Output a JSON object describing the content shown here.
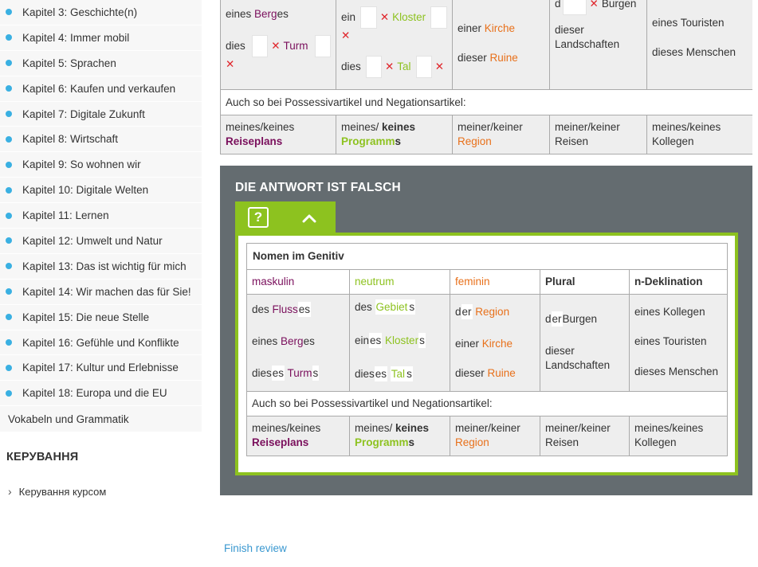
{
  "sidebar": {
    "chapters": [
      "Kapitel 3: Geschichte(n)",
      "Kapitel 4: Immer mobil",
      "Kapitel 5: Sprachen",
      "Kapitel 6: Kaufen und verkaufen",
      "Kapitel 7: Digitale Zukunft",
      "Kapitel 8: Wirtschaft",
      "Kapitel 9: So wohnen wir",
      "Kapitel 10: Digitale Welten",
      "Kapitel 11: Lernen",
      "Kapitel 12: Umwelt und Natur",
      "Kapitel 13: Das ist wichtig für mich",
      "Kapitel 14: Wir machen das für Sie!",
      "Kapitel 15: Die neue Stelle",
      "Kapitel 16: Gefühle und Konflikte",
      "Kapitel 17: Kultur und Erlebnisse",
      "Kapitel 18: Europa und die EU"
    ],
    "vocab": "Vokabeln und Grammatik",
    "section_title": "КЕРУВАННЯ",
    "manage_link": "Керування курсом"
  },
  "top": {
    "m_eines": "eines ",
    "m_Berg": "Berg",
    "m_es": "es",
    "m_dies": "dies",
    "m_Turm": "Turm",
    "n_ein": "ein",
    "n_Kloster": "Kloster",
    "n_dies": "dies",
    "n_Tal": "Tal",
    "f_einer": "einer ",
    "f_Kirche": "Kirche",
    "f_dieser": "dieser ",
    "f_Ruine": "Ruine",
    "p_d": "d",
    "p_Burgen": "Burgen",
    "p_dieser": "dieser",
    "p_Landschaft": "Landschaft",
    "p_en": "en",
    "nd_eines": "eines",
    "nd_Touristen": " Touristen",
    "nd_dieses": "dieses",
    "nd_Menschen": " Menschen",
    "possessive_note": "Auch so bei Possessivartikel und Negationsartikel:",
    "r_m_meines": "meines/keines",
    "r_m_Reiseplan": "Reiseplan",
    "r_m_s": "s",
    "r_n_meines": "meines/",
    "r_n_keines": " keines",
    "r_n_Programm": "Programm",
    "r_n_s": "s",
    "r_f_meiner": "meiner/keiner",
    "r_f_Region": "Region",
    "r_p_meiner": "meiner/keiner",
    "r_p_Reisen": "Reisen",
    "r_nd_meines": "meines/keines",
    "r_nd_Kollegen": "Kollegen"
  },
  "panel": {
    "title": "DIE ANTWORT IST FALSCH",
    "help_glyph": "?",
    "table_title": "Nomen im Genitiv",
    "headers": {
      "maskulin": "maskulin",
      "neutrum": "neutrum",
      "feminin": "feminin",
      "plural": "Plural",
      "ndekl": "n-Deklination"
    },
    "rows": {
      "m1_des": "des ",
      "m1_Fluss": "Fluss",
      "m1_es": "es",
      "m2_eines": "eines ",
      "m2_Berg": "Berg",
      "m2_es": "es",
      "m3_dies": "dies",
      "m3_es": "es",
      "m3_Turm": "Turm",
      "m3_s": "s",
      "n1_des": "des",
      "n1_Gebiet": "Gebiet",
      "n1_s": "s",
      "n2_ein": "ein",
      "n2_es": "es",
      "n2_Kloster": "Kloster",
      "n2_s": "s",
      "n3_dies": "dies",
      "n3_es": "es",
      "n3_Tal": "Tal",
      "n3_s": "s",
      "f1_d": "d",
      "f1_er": "er",
      "f1_Region": "Region",
      "f2_einer": "einer ",
      "f2_Kirche": "Kirche",
      "f3_dieser": "dieser ",
      "f3_Ruine": "Ruine",
      "p1_d": "d",
      "p1_er": "er",
      "p1_Burgen": "Burgen",
      "p2_dieser": "dieser",
      "p2_Landschaft": "Landschaft",
      "p2_en": "en",
      "nd1_eines": "eines",
      "nd1_Kollegen": " Kollegen",
      "nd2_eines": "eines",
      "nd2_Touristen": " Touristen",
      "nd3_dieses": "dieses",
      "nd3_Menschen": " Menschen"
    },
    "possessive_note": "Auch so bei Possessivartikel und Negationsartikel:",
    "poss": {
      "m_meines": "meines/keines",
      "m_Reiseplan": "Reiseplan",
      "m_s": "s",
      "n_meines": "meines/",
      "n_keines": " keines",
      "n_Programm": "Programm",
      "n_s": "s",
      "f_meiner": "meiner/keiner",
      "f_Region": "Region",
      "p_meiner": "meiner/keiner",
      "p_Reisen": "Reisen",
      "nd_meines": "meines/keines",
      "nd_Kollegen": "Kollegen"
    }
  },
  "finish_review": "Finish review",
  "colors": {
    "maskulin": "#7a0f5c",
    "neutrum": "#8dc21f",
    "feminin": "#e8701a",
    "error": "#e0262c",
    "panel": "#646c70",
    "link": "#3a98d0"
  }
}
